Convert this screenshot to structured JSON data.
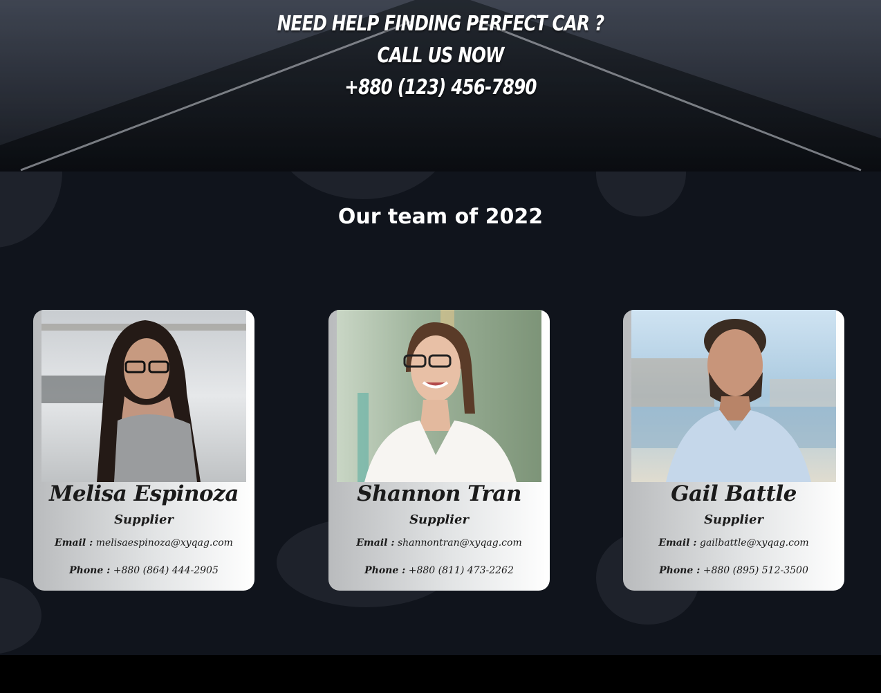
{
  "hero": {
    "line1": "Need help finding perfect car ?",
    "line2": "Call us now",
    "line3": "+880 (123) 456-7890"
  },
  "team": {
    "title": "Our team of 2022",
    "members": [
      {
        "name": "Melisa Espinoza",
        "role": "Supplier",
        "email_label": "Email :",
        "email": "melisaespinoza@xyqag.com",
        "phone_label": "Phone :",
        "phone": "+880 (864) 444-2905"
      },
      {
        "name": "Shannon Tran",
        "role": "Supplier",
        "email_label": "Email :",
        "email": "shannontran@xyqag.com",
        "phone_label": "Phone :",
        "phone": "+880 (811) 473-2262"
      },
      {
        "name": "Gail Battle",
        "role": "Supplier",
        "email_label": "Email :",
        "email": "gailbattle@xyqag.com",
        "phone_label": "Phone :",
        "phone": "+880 (895) 512-3500"
      }
    ]
  },
  "colors": {
    "section_bg": "#10141c",
    "bubble": "#1e222b",
    "card_gradient_start": "#b9bbbd",
    "card_gradient_end": "#ffffff",
    "text_dark": "#1a1a1a",
    "text_light": "#ffffff"
  }
}
